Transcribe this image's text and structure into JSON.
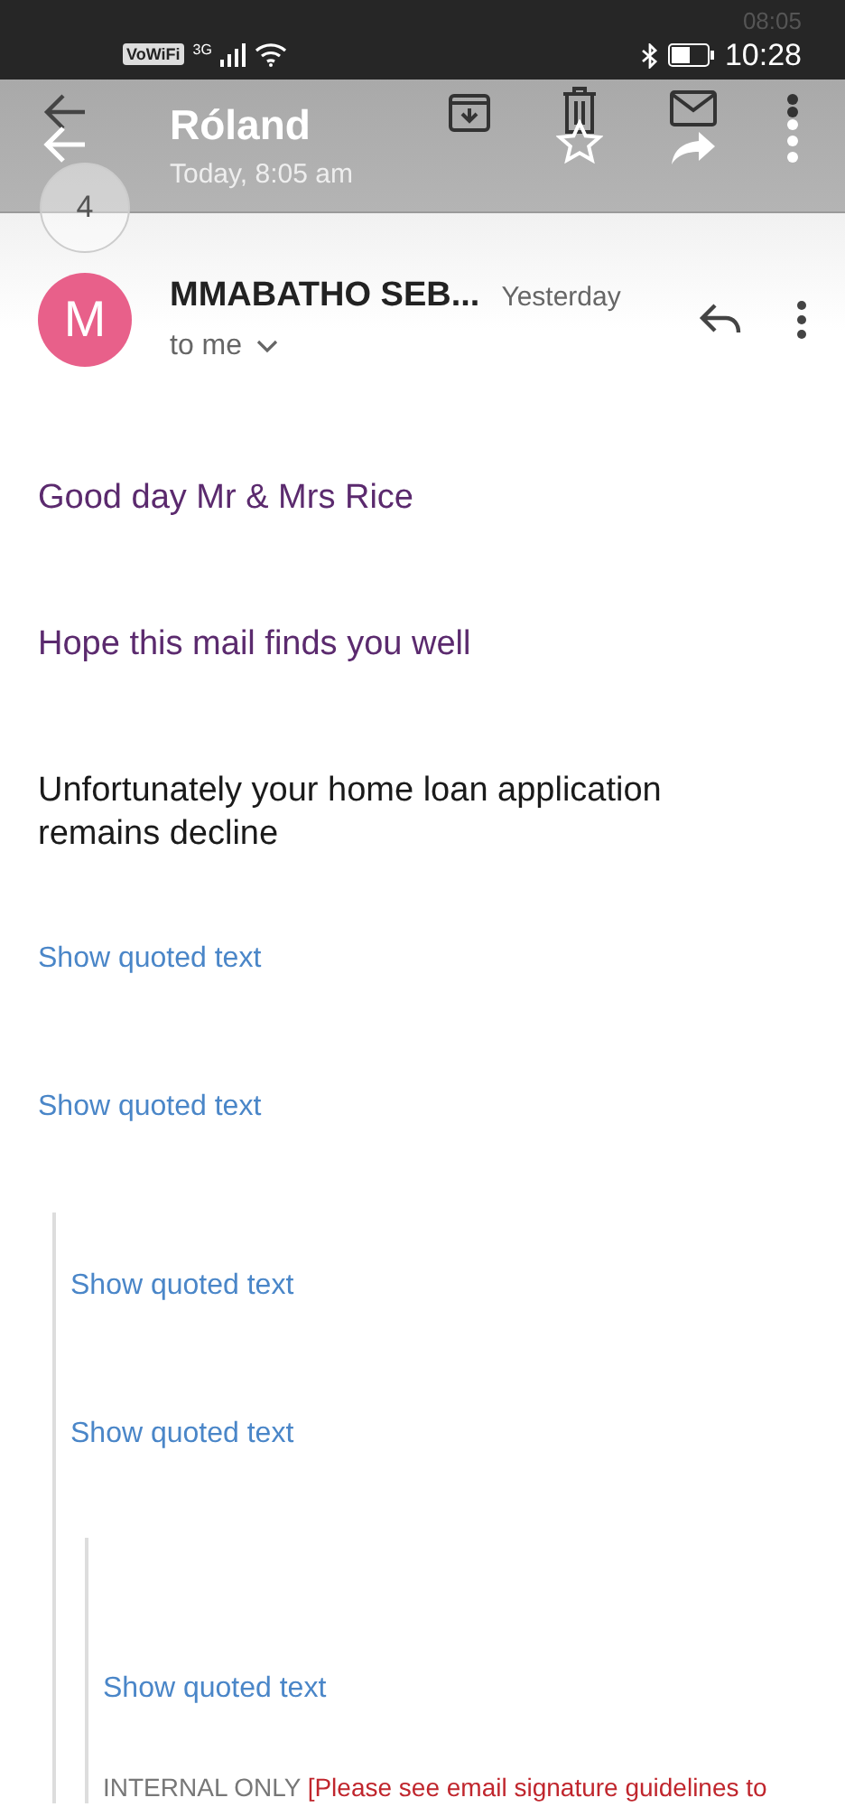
{
  "status_bar": {
    "ghost_time": "08:05",
    "wifi_calling": "VoWiFi",
    "network": "3G",
    "time": "10:28"
  },
  "toolbar": {
    "title": "Róland",
    "subtitle": "Today, 8:05 am",
    "thread_count": "4"
  },
  "message": {
    "avatar_letter": "M",
    "sender": "MMABATHO SEB...",
    "date": "Yesterday",
    "recipient": "to me"
  },
  "paragraphs": [
    {
      "text": "Good day Mr & Mrs Rice",
      "color": "#5b2a6e"
    },
    {
      "text": "Hope this mail finds you well",
      "color": "#5b2a6e"
    },
    {
      "text": "Unfortunately your home loan application remains decline",
      "color": "#1a1a1a"
    }
  ],
  "quoted": {
    "links": [
      "Show quoted text",
      "Show quoted text"
    ],
    "children": [
      {
        "links": [
          "Show quoted text",
          "Show quoted text"
        ],
        "children": [
          {
            "links": [
              "Show quoted text"
            ],
            "footer": {
              "label": "INTERNAL ONLY",
              "notice": "[Please see email signature guidelines to"
            }
          }
        ]
      }
    ]
  }
}
